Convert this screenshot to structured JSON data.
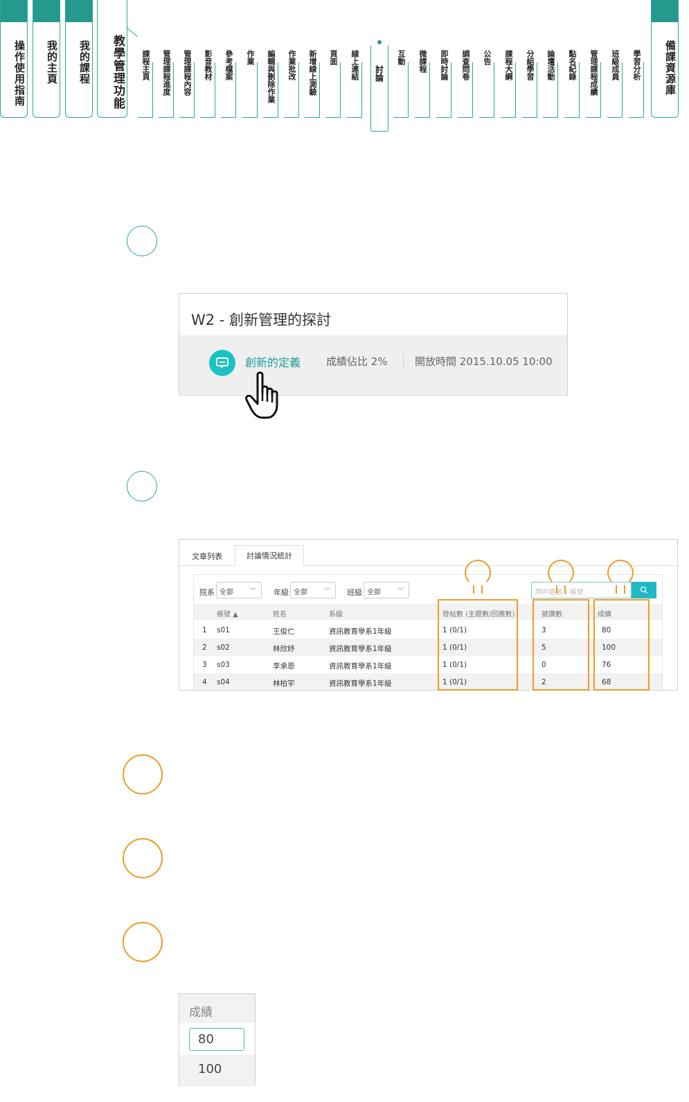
{
  "nav": {
    "main_tabs": [
      "操作使用指南",
      "我的主頁",
      "我的課程"
    ],
    "active_section": "教學管理功能",
    "right_tab": "備課資源庫",
    "sub_items": [
      "課程主頁",
      "管理課程進度",
      "管理課程內容",
      "影音教材",
      "參考檔案",
      "作業",
      "編輯與刪除作業",
      "作業批改",
      "新增線上測驗",
      "頁面",
      "線上連結",
      "討論",
      "互動",
      "微課程",
      "即時討論",
      "調查問卷",
      "公告",
      "課程大綱",
      "分組學習",
      "論壇活動",
      "點名紀錄",
      "管理課程成績",
      "班級成員",
      "學習分析"
    ],
    "active_item": "討論"
  },
  "card1": {
    "title": "W2 - 創新管理的探討",
    "topic": "創新的定義",
    "weight_label": "成績佔比 2%",
    "open_time_label": "開放時間 2015.10.05 10:00"
  },
  "card2": {
    "tabs": [
      "文章列表",
      "討論情況統計"
    ],
    "filters": [
      {
        "label": "院系",
        "value": "全部"
      },
      {
        "label": "年級",
        "value": "全部"
      },
      {
        "label": "班級",
        "value": "全部"
      }
    ],
    "search_placeholder": "用戶姓名 / 帳號",
    "columns": [
      "帳號 ▲",
      "姓名",
      "系級",
      "發帖數 (主題數/回應數)",
      "被讚數",
      "成績"
    ],
    "rows": [
      [
        "1",
        "s01",
        "王俊仁",
        "資訊教育學系1年級",
        "1 (0/1)",
        "3",
        "80"
      ],
      [
        "2",
        "s02",
        "林欣妤",
        "資訊教育學系1年級",
        "1 (0/1)",
        "5",
        "100"
      ],
      [
        "3",
        "s03",
        "李承恩",
        "資訊教育學系1年級",
        "1 (0/1)",
        "0",
        "76"
      ],
      [
        "4",
        "s04",
        "林柏宇",
        "資訊教育學系1年級",
        "1 (0/1)",
        "2",
        "68"
      ]
    ]
  },
  "grade_box": {
    "header": "成績",
    "input_value": "80",
    "next_value": "100"
  },
  "colors": {
    "teal": "#26998e",
    "accent_cyan": "#1cc2c4",
    "highlight_orange": "#f09a25"
  }
}
